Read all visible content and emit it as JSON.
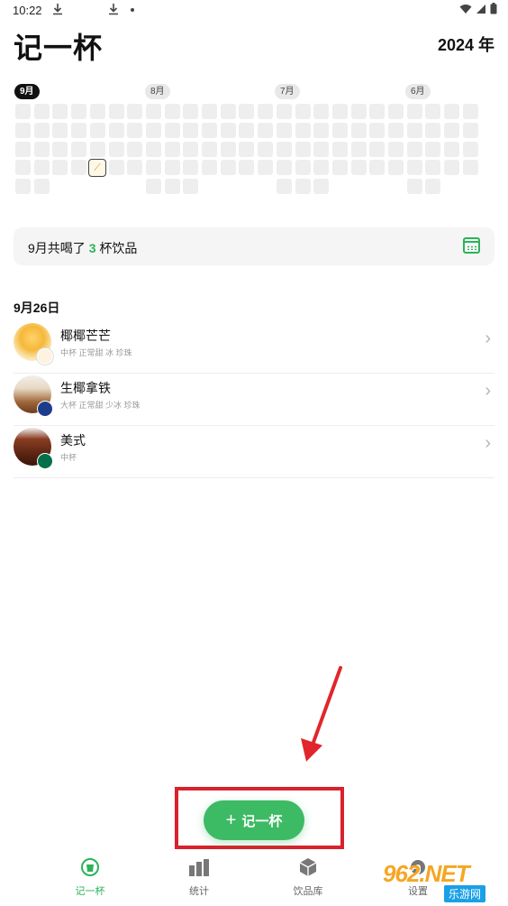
{
  "status_bar": {
    "time": "10:22",
    "icons_left": [
      "download-icon",
      "download-icon",
      "dot-icon"
    ],
    "icons_right": [
      "wifi-icon",
      "signal-icon",
      "battery-icon"
    ]
  },
  "header": {
    "title": "记一杯",
    "year": "2024 年"
  },
  "months": [
    {
      "label": "9月",
      "active": true
    },
    {
      "label": "8月",
      "active": false
    },
    {
      "label": "7月",
      "active": false
    },
    {
      "label": "6月",
      "active": false
    }
  ],
  "summary": {
    "prefix": "9月共喝了",
    "count": "3",
    "suffix": "杯饮品"
  },
  "list": {
    "date": "9月26日",
    "items": [
      {
        "name": "椰椰芒芒",
        "desc": "中杯  正常甜  冰  珍珠"
      },
      {
        "name": "生椰拿铁",
        "desc": "大杯  正常甜  少冰  珍珠"
      },
      {
        "name": "美式",
        "desc": "中杯"
      }
    ]
  },
  "fab": {
    "label": "记一杯"
  },
  "nav": {
    "items": [
      {
        "label": "记一杯",
        "active": true
      },
      {
        "label": "统计",
        "active": false
      },
      {
        "label": "饮品库",
        "active": false
      },
      {
        "label": "设置",
        "active": false
      }
    ]
  },
  "watermark": {
    "main": "962.NET",
    "sub": "乐游网"
  },
  "colors": {
    "accent": "#2bb35a",
    "fab": "#3dba64",
    "highlight": "#d8222c"
  }
}
